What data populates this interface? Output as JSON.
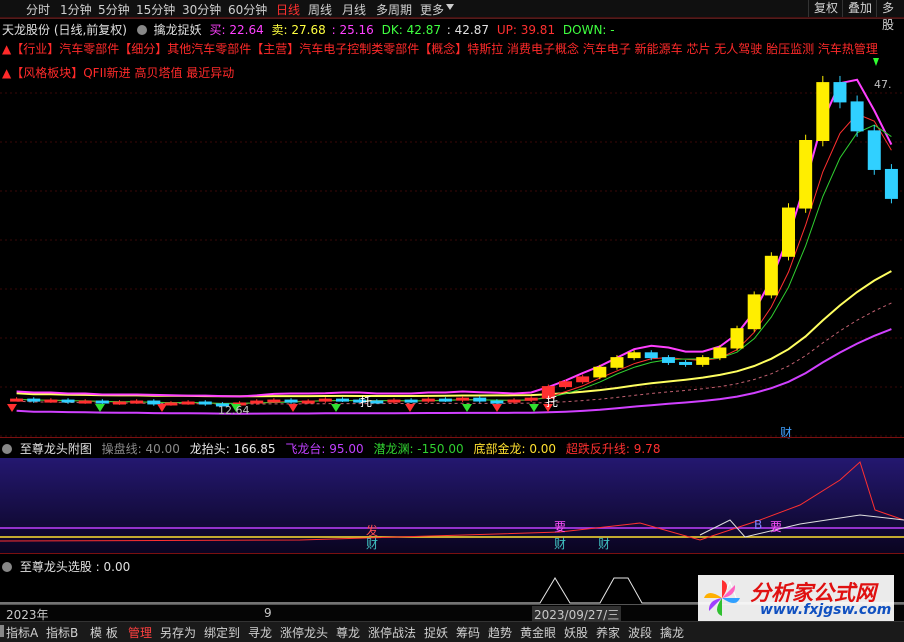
{
  "toolbar": {
    "periods": [
      "分时",
      "1分钟",
      "5分钟",
      "15分钟",
      "30分钟",
      "60分钟",
      "日线",
      "周线",
      "月线",
      "多周期",
      "更多"
    ],
    "active_period": "日线",
    "right_buttons": [
      "复权",
      "叠加",
      "多股"
    ]
  },
  "title_line": {
    "stock": "天龙股份 (日线,前复权)",
    "indicator": "擒龙捉妖",
    "buy": "买: 22.64",
    "sell": "卖: 27.68",
    "v1": ": 25.16",
    "dk": "DK: 42.87",
    "v2": ": 42.87",
    "up": "UP: 39.81",
    "down": "DOWN: -"
  },
  "info_line1": "▲【行业】汽车零部件【细分】其他汽车零部件【主营】汽车电子控制类零部件【概念】特斯拉 消费电子概念 汽车电子 新能源车 芯片 无人驾驶 胎压监测 汽车热管理",
  "info_line2": "▲【风格板块】QFII新进 高贝塔值 最近异动",
  "main_labels": {
    "price_top": "47.",
    "price_low": "12.64",
    "cai": "财",
    "tuo1": "托",
    "tuo2": "托"
  },
  "panel2": {
    "name": "至尊龙头附图",
    "items": [
      {
        "label": "操盘线: 40.00",
        "color": "#8a8a8a"
      },
      {
        "label": "龙抬头: 166.85",
        "color": "#e8e8e8"
      },
      {
        "label": "飞龙台: 95.00",
        "color": "#c040ff"
      },
      {
        "label": "潜龙渊: -150.00",
        "color": "#30d030"
      },
      {
        "label": "底部金龙: 0.00",
        "color": "#ffe030"
      },
      {
        "label": "超跌反升线: 9.78",
        "color": "#ff3030"
      }
    ],
    "marks": [
      "发",
      "要",
      "要",
      "财",
      "财",
      "财",
      "B"
    ]
  },
  "panel3": {
    "name": "至尊龙头选股 : 0.00"
  },
  "date_axis": [
    "2023年",
    "9",
    "2023/09/27/三"
  ],
  "bottom_tabs": [
    "指标A",
    "指标B",
    "模 板",
    "管理",
    "另存为",
    "绑定到",
    "寻龙",
    "涨停龙头",
    "尊龙",
    "涨停战法",
    "捉妖",
    "筹码",
    "趋势",
    "黄金眼",
    "妖股",
    "养家",
    "波段",
    "擒龙"
  ],
  "active_tab": "管理",
  "watermark": {
    "main": "分析家公式网",
    "sub": "www.fxjgsw.com"
  },
  "chart_data": {
    "type": "candlestick",
    "ylim": [
      10,
      50
    ],
    "closes": [
      13.2,
      13.0,
      13.1,
      12.9,
      13.0,
      12.8,
      12.9,
      13.0,
      12.7,
      12.8,
      12.9,
      12.7,
      12.64,
      12.8,
      13.0,
      13.1,
      12.9,
      13.0,
      13.2,
      13.1,
      13.0,
      12.9,
      13.1,
      13.0,
      13.2,
      13.1,
      13.3,
      13.0,
      12.9,
      13.1,
      13.3,
      14.5,
      15.0,
      15.5,
      16.5,
      17.5,
      18.0,
      17.5,
      17.0,
      16.8,
      17.5,
      18.5,
      20.5,
      24.0,
      28.0,
      33.0,
      40.0,
      46.0,
      44.0,
      41.0,
      37.0,
      34.0
    ]
  }
}
